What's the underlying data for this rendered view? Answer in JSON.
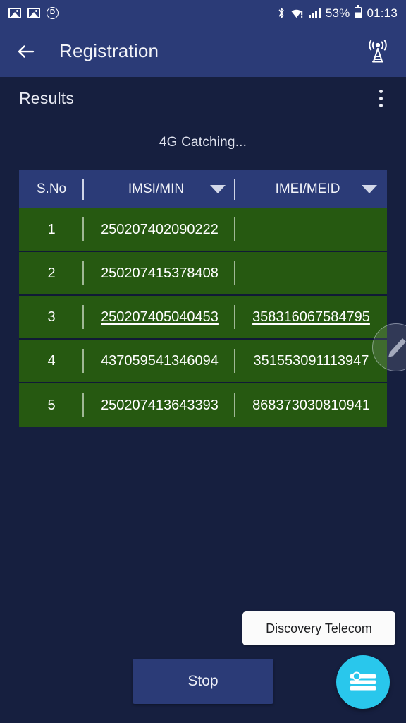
{
  "status_bar": {
    "icons_left": [
      "image-icon",
      "image-icon",
      "dt-badge-icon"
    ],
    "dt_label": "D",
    "bluetooth_icon": "bluetooth-icon",
    "wifi_icon": "wifi-warning-icon",
    "signal_icon": "cellular-signal-icon",
    "battery_percent": "53%",
    "battery_icon": "battery-icon",
    "time": "01:13"
  },
  "app_bar": {
    "back_icon": "back-arrow-icon",
    "title": "Registration",
    "action_icon": "cell-tower-icon"
  },
  "results": {
    "label": "Results",
    "overflow_icon": "more-vertical-icon",
    "status_text": "4G Catching..."
  },
  "table": {
    "columns": [
      "S.No",
      "IMSI/MIN",
      "IMEI/MEID"
    ],
    "rows": [
      {
        "sno": "1",
        "imsi": "250207402090222",
        "imei": "",
        "underlined": false
      },
      {
        "sno": "2",
        "imsi": "250207415378408",
        "imei": "",
        "underlined": false
      },
      {
        "sno": "3",
        "imsi": "250207405040453",
        "imei": "358316067584795",
        "underlined": true
      },
      {
        "sno": "4",
        "imsi": "437059541346094",
        "imei": "351553091113947",
        "underlined": false
      },
      {
        "sno": "5",
        "imsi": "250207413643393",
        "imei": "868373030810941",
        "underlined": false
      }
    ]
  },
  "edit_fab": {
    "icon": "pencil-icon"
  },
  "toast": {
    "text": "Discovery Telecom"
  },
  "bottom": {
    "stop_label": "Stop",
    "fab_icon": "settings-lines-icon"
  },
  "colors": {
    "primary_blue": "#2b3b77",
    "background": "#161f3f",
    "row_green": "#265911",
    "fab_cyan": "#29c7ec",
    "toast_bg": "#fbfbfb"
  }
}
